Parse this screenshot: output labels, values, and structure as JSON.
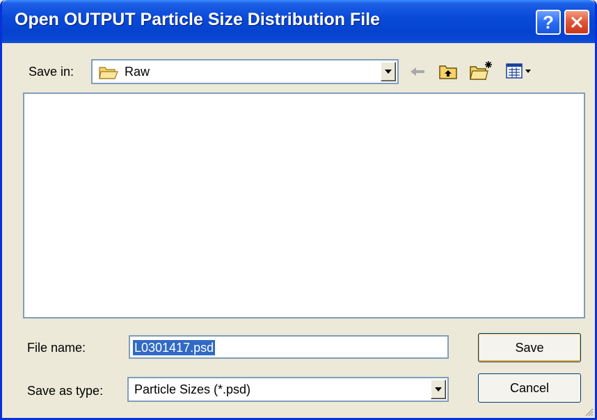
{
  "window": {
    "title": "Open OUTPUT Particle Size Distribution File",
    "help_icon": "question-mark-icon",
    "close_icon": "close-x-icon"
  },
  "save_in": {
    "label": "Save in:",
    "folder_icon": "folder-icon",
    "value": "Raw"
  },
  "toolbar": {
    "back_icon": "back-arrow-icon",
    "up_icon": "up-one-level-icon",
    "new_folder_icon": "new-folder-icon",
    "view_menu_icon": "view-menu-icon"
  },
  "file_name": {
    "label": "File name:",
    "value": "L0301417.psd"
  },
  "save_as_type": {
    "label": "Save as type:",
    "value": "Particle Sizes (*.psd)"
  },
  "buttons": {
    "save": "Save",
    "cancel": "Cancel"
  },
  "colors": {
    "titlebar": "#0a4ad8",
    "window_bg": "#ece9d8",
    "selection": "#316ac5",
    "close_button": "#e2583a"
  }
}
